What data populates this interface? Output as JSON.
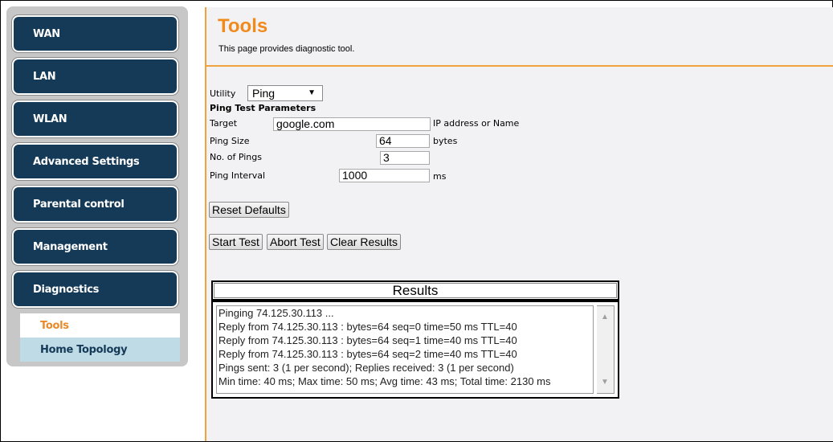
{
  "sidebar": {
    "items": [
      {
        "label": "WAN"
      },
      {
        "label": "LAN"
      },
      {
        "label": "WLAN"
      },
      {
        "label": "Advanced Settings"
      },
      {
        "label": "Parental control"
      },
      {
        "label": "Management"
      },
      {
        "label": "Diagnostics"
      }
    ],
    "subitems": [
      {
        "label": "Tools",
        "active": true
      },
      {
        "label": "Home Topology"
      }
    ]
  },
  "page": {
    "title": "Tools",
    "description": "This page provides diagnostic tool."
  },
  "form": {
    "utility_label": "Utility",
    "utility_value": "Ping",
    "section_title": "Ping Test Parameters",
    "target_label": "Target",
    "target_value": "google.com",
    "target_hint": "IP address or Name",
    "size_label": "Ping Size",
    "size_value": "64",
    "size_unit": "bytes",
    "count_label": "No. of Pings",
    "count_value": "3",
    "interval_label": "Ping Interval",
    "interval_value": "1000",
    "interval_unit": "ms"
  },
  "buttons": {
    "reset": "Reset Defaults",
    "start": "Start Test",
    "abort": "Abort Test",
    "clear": "Clear Results"
  },
  "results": {
    "title": "Results",
    "text": "Pinging 74.125.30.113 ...\nReply from 74.125.30.113 : bytes=64 seq=0 time=50 ms TTL=40\nReply from 74.125.30.113 : bytes=64 seq=1 time=40 ms TTL=40\nReply from 74.125.30.113 : bytes=64 seq=2 time=40 ms TTL=40\nPings sent: 3 (1 per second); Replies received: 3 (1 per second)\nMin time: 40 ms; Max time: 50 ms; Avg time: 43 ms; Total time: 2130 ms"
  },
  "colors": {
    "nav_bg": "#153a57",
    "accent": "#f08a1c",
    "active_sub_text": "#e8892a",
    "sub_bg": "#bfdbe6"
  }
}
